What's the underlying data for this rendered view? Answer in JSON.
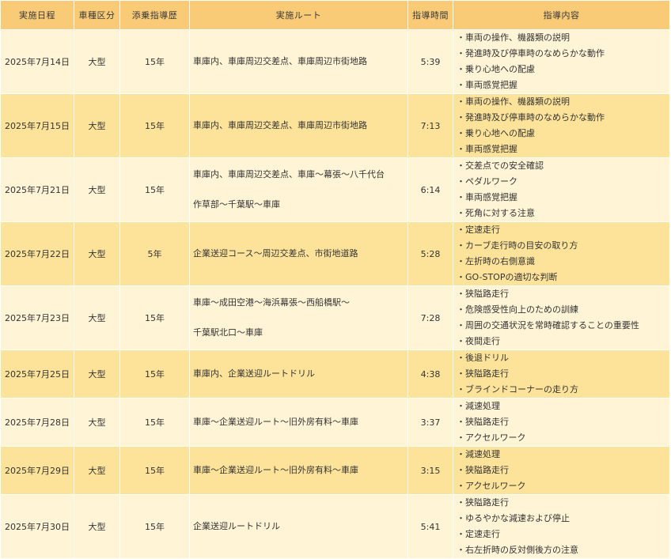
{
  "headers": [
    "実施日程",
    "車種区分",
    "添乗指導歴",
    "実施ルート",
    "指導時間",
    "指導内容"
  ],
  "rows": [
    {
      "date": "2025年7月14日",
      "vehicle": "大型",
      "history": "15年",
      "route": [
        "車庫内、車庫周辺交差点、車庫周辺市街地路"
      ],
      "time": "5:39",
      "content": [
        "車両の操作、機器類の説明",
        "発進時及び停車時のなめらかな動作",
        "乗り心地への配慮",
        "車両感覚把握"
      ]
    },
    {
      "date": "2025年7月15日",
      "vehicle": "大型",
      "history": "15年",
      "route": [
        "車庫内、車庫周辺交差点、車庫周辺市街地路"
      ],
      "time": "7:13",
      "content": [
        "車両の操作、機器類の説明",
        "発進時及び停車時のなめらかな動作",
        "乗り心地への配慮",
        "車両感覚把握"
      ]
    },
    {
      "date": "2025年7月21日",
      "vehicle": "大型",
      "history": "15年",
      "route": [
        "車庫内、車庫周辺交差点、車庫～幕張～八千代台",
        "作草部～千葉駅～車庫"
      ],
      "time": "6:14",
      "content": [
        "交差点での安全確認",
        "ペダルワーク",
        "車両感覚把握",
        "死角に対する注意"
      ]
    },
    {
      "date": "2025年7月22日",
      "vehicle": "大型",
      "history": "5年",
      "route": [
        "企業送迎コース～周辺交差点、市街地道路"
      ],
      "time": "5:28",
      "content": [
        "定速走行",
        "カーブ走行時の目安の取り方",
        "左折時の右側意識",
        "GO-STOPの適切な判断"
      ]
    },
    {
      "date": "2025年7月23日",
      "vehicle": "大型",
      "history": "15年",
      "route": [
        "車庫～成田空港～海浜幕張～西船橋駅～",
        "千葉駅北口～車庫"
      ],
      "time": "7:28",
      "content": [
        "狭隘路走行",
        "危険感受性向上のための訓練",
        "周囲の交通状況を常時確認することの重要性",
        "夜間走行"
      ]
    },
    {
      "date": "2025年7月25日",
      "vehicle": "大型",
      "history": "15年",
      "route": [
        "車庫内、企業送迎ルートドリル"
      ],
      "time": "4:38",
      "content": [
        "後退ドリル",
        "狭隘路走行",
        "ブラインドコーナーの走り方"
      ]
    },
    {
      "date": "2025年7月28日",
      "vehicle": "大型",
      "history": "15年",
      "route": [
        "車庫～企業送迎ルート～旧外房有料～車庫"
      ],
      "time": "3:37",
      "content": [
        "減速処理",
        "狭隘路走行",
        "アクセルワーク"
      ]
    },
    {
      "date": "2025年7月29日",
      "vehicle": "大型",
      "history": "15年",
      "route": [
        "車庫～企業送迎ルート～旧外房有料～車庫"
      ],
      "time": "3:15",
      "content": [
        "減速処理",
        "狭隘路走行",
        "アクセルワーク"
      ]
    },
    {
      "date": "2025年7月30日",
      "vehicle": "大型",
      "history": "15年",
      "route": [
        "企業送迎ルートドリル"
      ],
      "time": "5:41",
      "content": [
        "狭隘路走行",
        "ゆるやかな減速および停止",
        "定速走行",
        "右左折時の反対側後方の注意"
      ]
    }
  ]
}
